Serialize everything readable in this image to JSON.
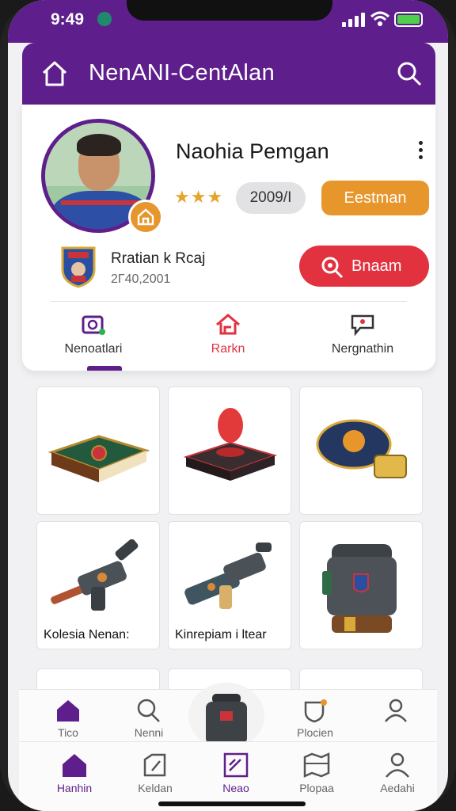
{
  "status": {
    "time": "9:49"
  },
  "appbar": {
    "title": "NenANI-CentAlan"
  },
  "profile": {
    "name": "Naohia Pemgan",
    "stars": "★★★",
    "id": "2009/I",
    "primary_action": "Eestman",
    "club": {
      "name": "Rratian k Rcaj",
      "date": "2Г40,2001"
    },
    "secondary_action": "Bnaam",
    "tabs": [
      {
        "label": "Nenoatlari",
        "color": "#5e1f8c"
      },
      {
        "label": "Rarkn",
        "color": "#e2323f"
      },
      {
        "label": "Nergnathin",
        "color": "#333333"
      }
    ]
  },
  "grid": {
    "cards": [
      {
        "name": "book-item",
        "caption": ""
      },
      {
        "name": "joystick-item",
        "caption": ""
      },
      {
        "name": "badge-item",
        "caption": ""
      },
      {
        "name": "rifle-item",
        "caption": "Kolesia Nenan:"
      },
      {
        "name": "blaster-item",
        "caption": "Kinrepiam i ltear"
      },
      {
        "name": "backpack-item",
        "caption": ""
      }
    ]
  },
  "subnav": {
    "items": [
      {
        "label": "Tico"
      },
      {
        "label": "Nenni"
      },
      {
        "label": ""
      },
      {
        "label": "Plocien"
      },
      {
        "label": ""
      }
    ]
  },
  "mainnav": {
    "items": [
      {
        "label": "Hanhin"
      },
      {
        "label": "Keldan"
      },
      {
        "label": "Neao"
      },
      {
        "label": "Plopaa"
      },
      {
        "label": "Aedahi"
      }
    ]
  },
  "colors": {
    "primary": "#5e1f8c",
    "accent_orange": "#e7962b",
    "accent_red": "#e2323f"
  }
}
